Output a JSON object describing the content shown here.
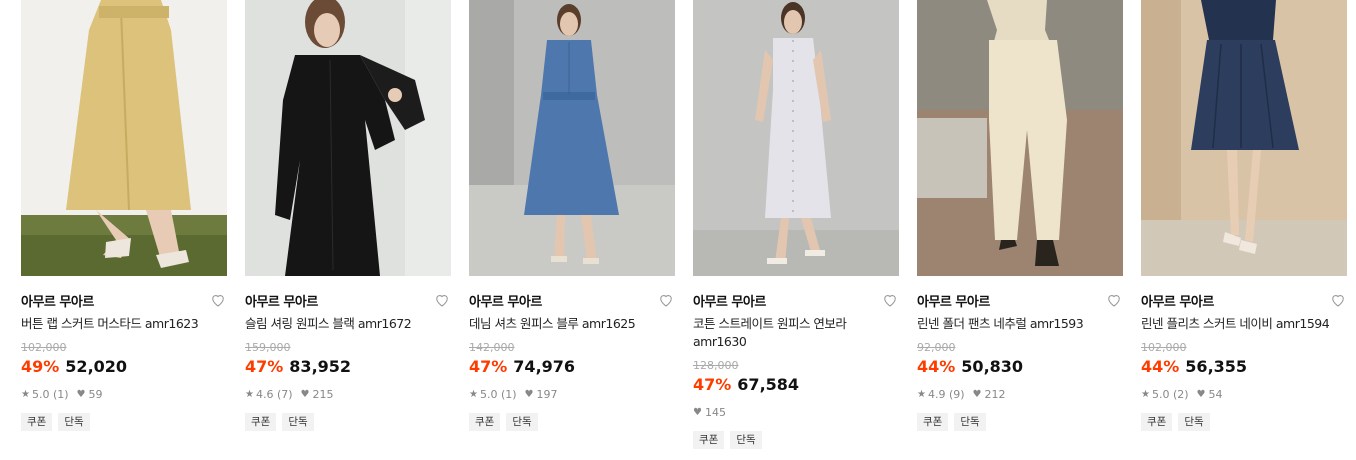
{
  "colors": {
    "discount": "#ff3c00",
    "tag_bg": "#f2f2f2",
    "strike": "#aaaaaa"
  },
  "products": [
    {
      "brand": "아무르 무아르",
      "title": "버튼 랩 스커트 머스타드 amr1623",
      "original_price": "102,000",
      "discount": "49%",
      "price": "52,020",
      "rating": "5.0 (1)",
      "likes": "59",
      "tags": [
        "쿠폰",
        "단독"
      ],
      "image": "mustard-wrap-skirt-photo"
    },
    {
      "brand": "아무르 무아르",
      "title": "슬림 셔링 원피스 블랙 amr1672",
      "original_price": "159,000",
      "discount": "47%",
      "price": "83,952",
      "rating": "4.6 (7)",
      "likes": "215",
      "tags": [
        "쿠폰",
        "단독"
      ],
      "image": "black-shirring-dress-photo"
    },
    {
      "brand": "아무르 무아르",
      "title": "데님 셔츠 원피스 블루 amr1625",
      "original_price": "142,000",
      "discount": "47%",
      "price": "74,976",
      "rating": "5.0 (1)",
      "likes": "197",
      "tags": [
        "쿠폰",
        "단독"
      ],
      "image": "blue-denim-dress-photo"
    },
    {
      "brand": "아무르 무아르",
      "title": "코튼 스트레이트 원피스 연보라 amr1630",
      "original_price": "128,000",
      "discount": "47%",
      "price": "67,584",
      "rating": "",
      "likes": "145",
      "tags": [
        "쿠폰",
        "단독"
      ],
      "image": "lavender-cotton-dress-photo"
    },
    {
      "brand": "아무르 무아르",
      "title": "린넨 폴더 팬츠 네추럴 amr1593",
      "original_price": "92,000",
      "discount": "44%",
      "price": "50,830",
      "rating": "4.9 (9)",
      "likes": "212",
      "tags": [
        "쿠폰",
        "단독"
      ],
      "image": "natural-linen-pants-photo"
    },
    {
      "brand": "아무르 무아르",
      "title": "린넨 플리츠 스커트 네이비 amr1594",
      "original_price": "102,000",
      "discount": "44%",
      "price": "56,355",
      "rating": "5.0 (2)",
      "likes": "54",
      "tags": [
        "쿠폰",
        "단독"
      ],
      "image": "navy-pleats-skirt-photo"
    }
  ]
}
